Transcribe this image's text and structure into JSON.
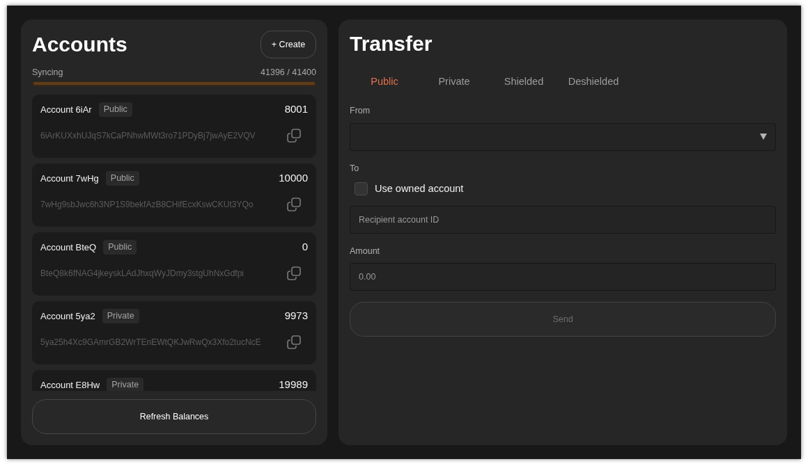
{
  "accounts_panel": {
    "title": "Accounts",
    "create_button": "+ Create",
    "sync": {
      "label": "Syncing",
      "progress": "41396 / 41400",
      "level": 0.9999
    },
    "accounts": [
      {
        "name": "Account 6iAr",
        "visibility": "Public",
        "balance": "8001",
        "address": "6iArKUXxhUJqS7kCaPNhwMWt3ro71PDyBj7jwAyE2VQV"
      },
      {
        "name": "Account 7wHg",
        "visibility": "Public",
        "balance": "10000",
        "address": "7wHg9sbJwc6h3NP1S9bekfAzB8CHifEcxKswCKUt3YQo"
      },
      {
        "name": "Account BteQ",
        "visibility": "Public",
        "balance": "0",
        "address": "BteQ8k6fNAG4jkeyskLAdJhxqWyJDmy3stgUhNxGdfpi"
      },
      {
        "name": "Account 5ya2",
        "visibility": "Private",
        "balance": "9973",
        "address": "5ya25h4Xc9GAmrGB2WrTEnEWtQKJwRwQx3Xfo2tucNcE"
      },
      {
        "name": "Account E8Hw",
        "visibility": "Private",
        "balance": "19989"
      }
    ],
    "refresh_button": "Refresh Balances"
  },
  "transfer_panel": {
    "title": "Transfer",
    "tabs": [
      {
        "label": "Public",
        "selected": true
      },
      {
        "label": "Private",
        "selected": false
      },
      {
        "label": "Shielded",
        "selected": false
      },
      {
        "label": "Deshielded",
        "selected": false
      }
    ],
    "from": {
      "label": "From"
    },
    "to": {
      "label": "To",
      "use_owned_account": {
        "label": "Use owned account",
        "checked": false
      },
      "recipient": {
        "placeholder": "Recipient account ID"
      }
    },
    "amount": {
      "label": "Amount",
      "placeholder": "0.00"
    },
    "send_button": {
      "label": "Send",
      "disabled": true
    }
  }
}
